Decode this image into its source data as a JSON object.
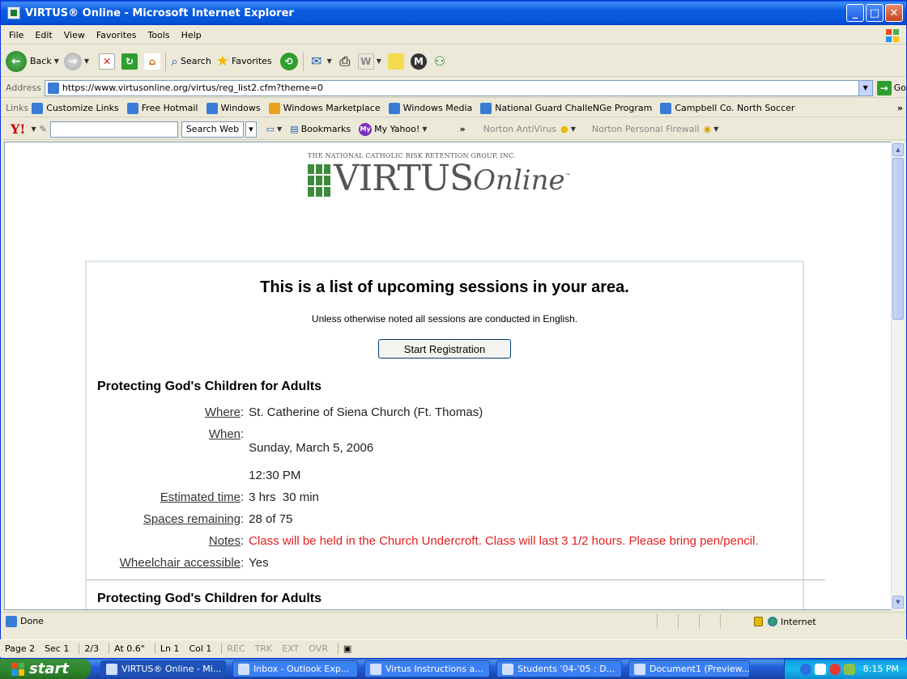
{
  "window": {
    "title": "VIRTUS® Online - Microsoft Internet Explorer"
  },
  "menu": {
    "items": [
      "File",
      "Edit",
      "View",
      "Favorites",
      "Tools",
      "Help"
    ]
  },
  "toolbar": {
    "back": "Back",
    "search": "Search",
    "favorites": "Favorites"
  },
  "address": {
    "label": "Address",
    "url": "https://www.virtusonline.org/virtus/reg_list2.cfm?theme=0",
    "go": "Go"
  },
  "links": {
    "label": "Links",
    "items": [
      "Customize Links",
      "Free Hotmail",
      "Windows",
      "Windows Marketplace",
      "Windows Media",
      "National Guard ChalleNGe Program",
      "Campbell Co. North Soccer"
    ],
    "more": "»"
  },
  "yahoo": {
    "logo": "Y!",
    "search_button": "Search Web",
    "bookmarks": "Bookmarks",
    "my_yahoo": "My Yahoo!",
    "norton_av": "Norton AntiVirus",
    "norton_fw": "Norton Personal Firewall",
    "more": "»"
  },
  "page": {
    "logo_tagline": "THE NATIONAL CATHOLIC RISK RETENTION GROUP, INC.",
    "logo_word": "VIRTUS",
    "logo_online": "Online",
    "logo_tm": "™",
    "heading": "This is a list of upcoming sessions in your area.",
    "language_note": "Unless otherwise noted all sessions are conducted in English.",
    "start_button": "Start Registration",
    "session": {
      "title": "Protecting God's Children for Adults",
      "where_label": "Where",
      "where": "St. Catherine of Siena Church (Ft. Thomas)",
      "when_label": "When",
      "when_date": "Sunday, March 5, 2006",
      "when_time": "12:30 PM",
      "time_label": "Estimated time",
      "time": "3 hrs  30 min",
      "spaces_label": "Spaces remaining",
      "spaces": "28 of 75",
      "notes_label": "Notes",
      "notes": "Class will be held in the Church Undercroft. Class will last 3 1/2 hours. Please bring pen/pencil.",
      "wheelchair_label": "Wheelchair accessible",
      "wheelchair": "Yes"
    },
    "next_session_title": "Protecting God's Children for Adults"
  },
  "status": {
    "text": "Done",
    "zone": "Internet"
  },
  "word_status": {
    "page": "Page 2",
    "sec": "Sec 1",
    "pages": "2/3",
    "at": "At 0.6\"",
    "ln": "Ln 1",
    "col": "Col 1",
    "rec": "REC",
    "trk": "TRK",
    "ext": "EXT",
    "ovr": "OVR"
  },
  "taskbar": {
    "start": "start",
    "tasks": [
      "VIRTUS® Online - Mi...",
      "Inbox - Outlook Exp...",
      "Virtus Instructions a...",
      "Students '04-'05 : D...",
      "Document1 (Preview..."
    ],
    "clock": "8:15 PM"
  }
}
